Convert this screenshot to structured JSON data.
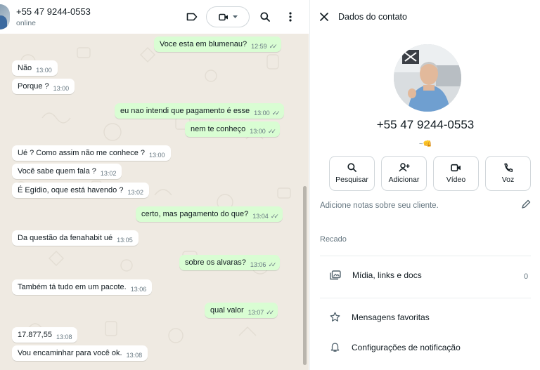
{
  "chat_header": {
    "name": "+55 47 9244-0553",
    "status": "online"
  },
  "messages": [
    {
      "dir": "out",
      "text": "Voce esta em blumenau?",
      "time": "12:59",
      "ticks": true
    },
    {
      "dir": "in",
      "text": "Não",
      "time": "13:00"
    },
    {
      "dir": "in",
      "text": "Porque ?",
      "time": "13:00"
    },
    {
      "dir": "out",
      "text": "eu nao intendi que pagamento é esse",
      "time": "13:00",
      "ticks": true
    },
    {
      "dir": "out",
      "text": "nem te conheço",
      "time": "13:00",
      "ticks": true
    },
    {
      "dir": "in",
      "text": "Ué ? Como assim não me conhece ?",
      "time": "13:00"
    },
    {
      "dir": "in",
      "text": "Você sabe quem fala ?",
      "time": "13:02"
    },
    {
      "dir": "in",
      "text": "É Egídio, oque está havendo ?",
      "time": "13:02"
    },
    {
      "dir": "out",
      "text": "certo, mas pagamento do que?",
      "time": "13:04",
      "ticks": true
    },
    {
      "dir": "in",
      "text": "Da questão da fenahabit ué",
      "time": "13:05"
    },
    {
      "dir": "out",
      "text": "sobre os alvaras?",
      "time": "13:06",
      "ticks": true
    },
    {
      "dir": "in",
      "text": "Também tá tudo em um pacote.",
      "time": "13:06"
    },
    {
      "dir": "out",
      "text": "qual valor",
      "time": "13:07",
      "ticks": true
    },
    {
      "dir": "in",
      "text": "17.877,55",
      "time": "13:08"
    },
    {
      "dir": "in",
      "text": "Vou encaminhar para você ok.",
      "time": "13:08"
    }
  ],
  "contact_panel": {
    "title": "Dados do contato",
    "phone": "+55 47 9244-0553",
    "about": "~👊",
    "actions": [
      {
        "label": "Pesquisar",
        "icon": "search-icon"
      },
      {
        "label": "Adicionar",
        "icon": "add-person-icon"
      },
      {
        "label": "Vídeo",
        "icon": "video-icon"
      },
      {
        "label": "Voz",
        "icon": "phone-icon"
      }
    ],
    "notes_placeholder": "Adicione notas sobre seu cliente.",
    "recado_label": "Recado",
    "media_label": "Mídia, links e docs",
    "media_count": "0",
    "favorites_label": "Mensagens favoritas",
    "notifications_label": "Configurações de notificação"
  },
  "colors": {
    "incoming_bubble": "#ffffff",
    "outgoing_bubble": "#d9fdd3",
    "chat_background": "#efeae2",
    "icon_grey": "#54656f"
  }
}
